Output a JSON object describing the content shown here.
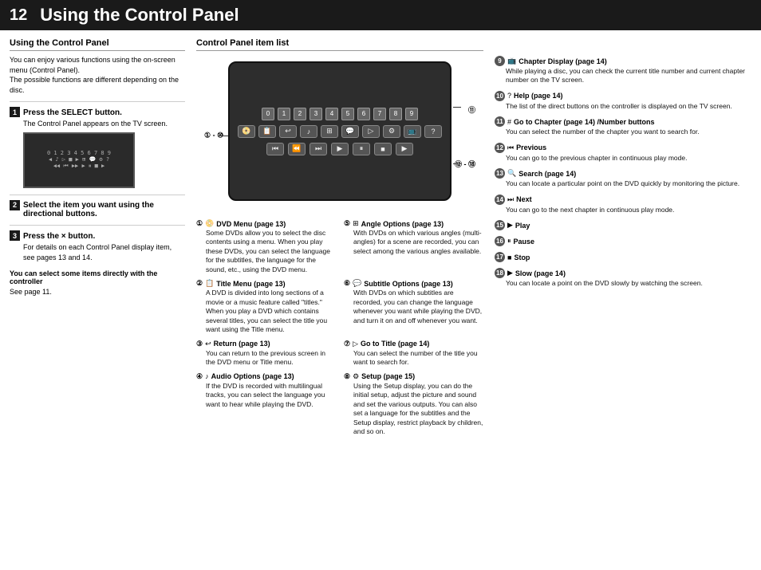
{
  "header": {
    "page_number": "12",
    "title": "Using the Control Panel"
  },
  "left_column": {
    "section_title": "Using the Control Panel",
    "intro": "You can enjoy various functions using the on-screen menu (Control Panel).\nThe possible functions are different depending on the disc.",
    "steps": [
      {
        "num": "1",
        "label": "Press the SELECT button.",
        "desc": "The Control Panel appears on the TV screen."
      },
      {
        "num": "2",
        "label": "Select the item you want using the directional buttons."
      },
      {
        "num": "3",
        "label": "Press the × button.",
        "desc": "For details on each Control Panel display item, see pages 13 and 14."
      }
    ],
    "note_bold": "You can select some items directly with the controller",
    "note_text": "See page 11."
  },
  "middle_column": {
    "section_title": "Control Panel item list",
    "callout_left": "① - ⑩",
    "callout_right_top": "⑪",
    "callout_right_bottom": "⑫ - ⑱",
    "items": [
      {
        "num": "①",
        "icon": "📀",
        "title": "DVD Menu (page 13)",
        "desc": "Some DVDs allow you to select the disc contents using a menu. When you play these DVDs, you can select the language for the subtitles, the language for the sound, etc., using the DVD menu."
      },
      {
        "num": "②",
        "icon": "📋",
        "title": "Title Menu (page 13)",
        "desc": "A DVD is divided into long sections of a movie or a music feature called \"titles.\" When you play a DVD which contains several titles, you can select the title you want using the Title menu."
      },
      {
        "num": "③",
        "icon": "↩",
        "title": "Return (page 13)",
        "desc": "You can return to the previous screen in the DVD menu or Title menu."
      },
      {
        "num": "④",
        "icon": "♪",
        "title": "Audio Options (page 13)",
        "desc": "If the DVD is recorded with multilingual tracks, you can select the language you want to hear while playing the DVD."
      },
      {
        "num": "⑤",
        "icon": "⊞",
        "title": "Angle Options (page 13)",
        "desc": "With DVDs on which various angles (multi-angles) for a scene are recorded, you can select among the various angles available."
      },
      {
        "num": "⑥",
        "icon": "💬",
        "title": "Subtitle Options (page 13)",
        "desc": "With DVDs on which subtitles are recorded, you can change the language whenever you want while playing the DVD, and turn it on and off whenever you want."
      },
      {
        "num": "⑦",
        "icon": "▷",
        "title": "Go to Title (page 14)",
        "desc": "You can select the number of the title you want to search for."
      },
      {
        "num": "⑧",
        "icon": "⚙",
        "title": "Setup (page 15)",
        "desc": "Using the Setup display, you can do the initial setup, adjust the picture and sound and set the various outputs. You can also set a language for the subtitles and the Setup display, restrict playback by children, and so on."
      }
    ]
  },
  "right_column": {
    "items": [
      {
        "num": "⑨",
        "icon": "📺",
        "title": "Chapter Display (page 14)",
        "desc": "While playing a disc, you can check the current title number and current chapter number on the TV screen."
      },
      {
        "num": "⑩",
        "icon": "?",
        "title": "Help (page 14)",
        "desc": "The list of the direct buttons on the controller is displayed on the TV screen."
      },
      {
        "num": "⑪",
        "icon": "#",
        "title": "Go to Chapter (page 14) /Number buttons",
        "desc": "You can select the number of the chapter you want to search for."
      },
      {
        "num": "⑫",
        "icon": "|◀◀",
        "title": "Previous",
        "desc": "You can go to the previous chapter in continuous play mode."
      },
      {
        "num": "⑬",
        "icon": "🔍",
        "title": "Search (page 14)",
        "desc": "You can locate a particular point on the DVD quickly by monitoring the picture."
      },
      {
        "num": "⑭",
        "icon": "▶▶|",
        "title": "Next",
        "desc": "You can go to the next chapter in continuous play mode."
      },
      {
        "num": "⑮",
        "icon": "▶",
        "title": "Play",
        "desc": ""
      },
      {
        "num": "⑯",
        "icon": "⏸",
        "title": "Pause",
        "desc": ""
      },
      {
        "num": "⑰",
        "icon": "■",
        "title": "Stop",
        "desc": ""
      },
      {
        "num": "⑱",
        "icon": "▶",
        "title": "Slow (page 14)",
        "desc": "You can locate a point on the DVD slowly by watching the screen."
      }
    ]
  }
}
